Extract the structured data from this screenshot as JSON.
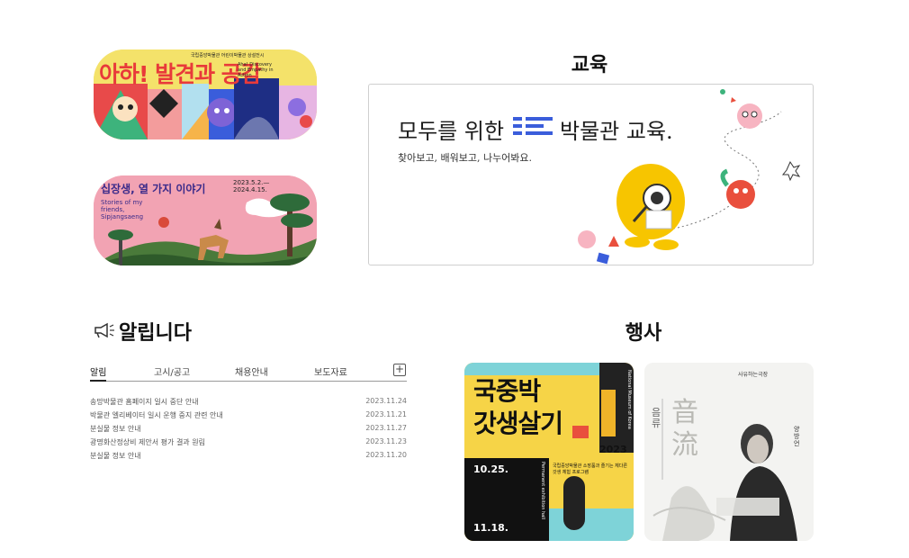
{
  "banners": [
    {
      "title": "아하! 발견과 공감",
      "top_caption": "국립중앙박물관 어린이박물관 상설전시",
      "english": "Aha! Discovery and Empathy in Action"
    },
    {
      "title": "십장생, 열 가지 이야기",
      "dates": "2023.5.2.— 2024.4.15.",
      "english": "Stories of my friends, Sipjangsaeng"
    }
  ],
  "education": {
    "title": "교육",
    "headline_before": "모두를 위한",
    "headline_after": "박물관 교육.",
    "subtitle": "찾아보고, 배워보고, 나누어봐요."
  },
  "notices": {
    "title": "알립니다",
    "tabs": [
      "알림",
      "고시/공고",
      "채용안내",
      "보도자료"
    ],
    "add_label": "+",
    "items": [
      {
        "title": "송망박물관 홈페이지 일시 중단 안내",
        "date": "2023.11.24"
      },
      {
        "title": "박물관 엘리베이터 일시 운행 중지 관련 안내",
        "date": "2023.11.21"
      },
      {
        "title": "분실물 정보 안내",
        "date": "2023.11.27"
      },
      {
        "title": "광명화산정상비 제안서 평가 결과 원림",
        "date": "2023.11.23"
      },
      {
        "title": "분실물 정보 안내",
        "date": "2023.11.20"
      }
    ]
  },
  "events": {
    "title": "행사",
    "poster1": {
      "title_line1": "국중박",
      "title_line2": "갓생살기",
      "year": "2023",
      "start": "10.25.",
      "end": "11.18.",
      "side_text": "National Museum of Korea",
      "vertical_text": "Permanent exhibition hall",
      "desc": "국립중앙박물관 소장품과 즐기는 체다른 갓생 체험 프로그램"
    },
    "poster2": {
      "header": "사유하는극장",
      "name": "양방언",
      "title_char1": "音",
      "title_char2": "流",
      "title_hangul": "음류"
    }
  },
  "colors": {
    "accent_blue": "#3a5ddb",
    "edu_yellow": "#f7c500",
    "edu_red": "#e94f3d",
    "poster_yellow": "#f6d447"
  }
}
